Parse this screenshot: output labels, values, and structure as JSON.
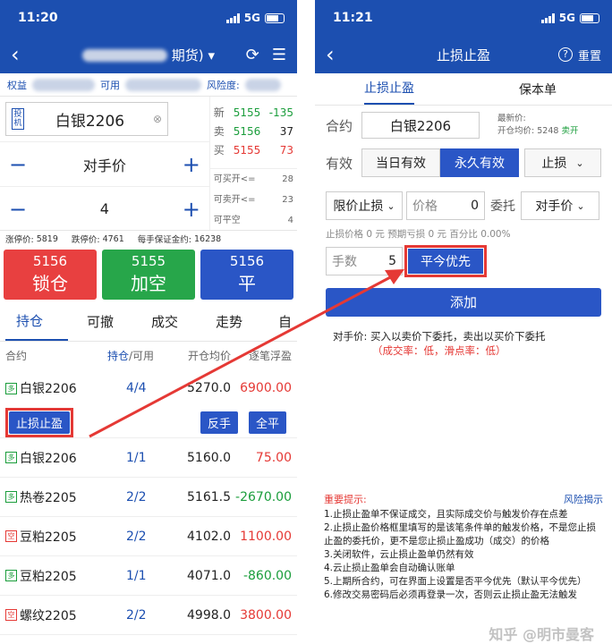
{
  "left": {
    "status_time": "11:20",
    "network": "5G",
    "nav_title_suffix": "期货)",
    "info": {
      "equity_label": "权益",
      "available_label": "可用",
      "risk_label": "风险度:"
    },
    "contract_tag": "投机",
    "contract_name": "白银2206",
    "quotes": [
      {
        "label": "新",
        "price": "5155",
        "change": "-135"
      },
      {
        "label": "卖",
        "price": "5156",
        "change": "37"
      },
      {
        "label": "买",
        "price": "5155",
        "change": "73"
      }
    ],
    "price_mode": "对手价",
    "quantity": "4",
    "limits": [
      {
        "label": "可买开<=",
        "value": "28"
      },
      {
        "label": "可卖开<=",
        "value": "23"
      },
      {
        "label": "可平空",
        "value": "4"
      }
    ],
    "limit_info": {
      "up_label": "涨停价:",
      "up_value": "5819",
      "down_label": "跌停价:",
      "down_value": "4761",
      "margin_label": "每手保证金约:",
      "margin_value": "16238"
    },
    "actions": [
      {
        "price": "5156",
        "label": "锁仓",
        "color": "#e84040"
      },
      {
        "price": "5155",
        "label": "加空",
        "color": "#27a64a"
      },
      {
        "price": "5156",
        "label": "平",
        "color": "#2a56c6"
      }
    ],
    "tabs": [
      "持仓",
      "可撤",
      "成交",
      "走势",
      "自"
    ],
    "table_header": {
      "contract": "合约",
      "hold": "持仓",
      "slash": "/可用",
      "open_price": "开仓均价",
      "profit": "逐笔浮盈"
    },
    "positions": [
      {
        "tag": "多",
        "name": "白银2206",
        "qty": "4/4",
        "price": "5270.0",
        "profit": "6900.00",
        "profit_color": "red"
      },
      {
        "tag": "多",
        "name": "白银2206",
        "qty": "1/1",
        "price": "5160.0",
        "profit": "75.00",
        "profit_color": "red"
      },
      {
        "tag": "多",
        "name": "热卷2205",
        "qty": "2/2",
        "price": "5161.5",
        "profit": "-2670.00",
        "profit_color": "green"
      },
      {
        "tag": "空",
        "name": "豆粕2205",
        "qty": "2/2",
        "price": "4102.0",
        "profit": "1100.00",
        "profit_color": "red"
      },
      {
        "tag": "多",
        "name": "豆粕2205",
        "qty": "1/1",
        "price": "4071.0",
        "profit": "-860.00",
        "profit_color": "green"
      },
      {
        "tag": "空",
        "name": "螺纹2205",
        "qty": "2/2",
        "price": "4998.0",
        "profit": "3800.00",
        "profit_color": "red"
      }
    ],
    "row_buttons": {
      "stop": "止损止盈",
      "reverse": "反手",
      "close_all": "全平"
    }
  },
  "right": {
    "status_time": "11:21",
    "network": "5G",
    "title": "止损止盈",
    "reset": "重置",
    "tabs": [
      "止损止盈",
      "保本单"
    ],
    "contract_label": "合约",
    "contract_value": "白银2206",
    "latest_label": "最新价:",
    "open_label": "开仓均价:",
    "open_value": "5248",
    "open_dir": "卖开",
    "validity_label": "有效",
    "validity_opts": [
      "当日有效",
      "永久有效",
      "止损"
    ],
    "limit_stop": "限价止损",
    "price_label": "价格",
    "price_value": "0",
    "order_label": "委托",
    "order_value": "对手价",
    "stop_info": "止损价格 0 元   预期亏损 0 元   百分比 0.00%",
    "lots_label": "手数",
    "lots_value": "5",
    "close_priority": "平今优先",
    "add": "添加",
    "opp_label": "对手价:",
    "opp_desc": "买入以卖价下委托，卖出以买价下委托",
    "opp_rate": "（成交率：低，滑点率：低）",
    "notice_title": "重要提示:",
    "risk_link": "风险揭示",
    "notices": [
      "1.止损止盈单不保证成交，且实际成交价与触发价存在点差",
      "2.止损止盈价格框里填写的是该笔条件单的触发价格，不是您止损止盈的委托价，更不是您止损止盈成功（成交）的价格",
      "3.关闭软件，云止损止盈单仍然有效",
      "4.云止损止盈单会自动确认账单",
      "5.上期所合约，可在界面上设置是否平今优先（默认平今优先）",
      "6.修改交易密码后必须再登录一次，否则云止损止盈无法触发"
    ],
    "watermark": "知乎 @明市曼客"
  }
}
